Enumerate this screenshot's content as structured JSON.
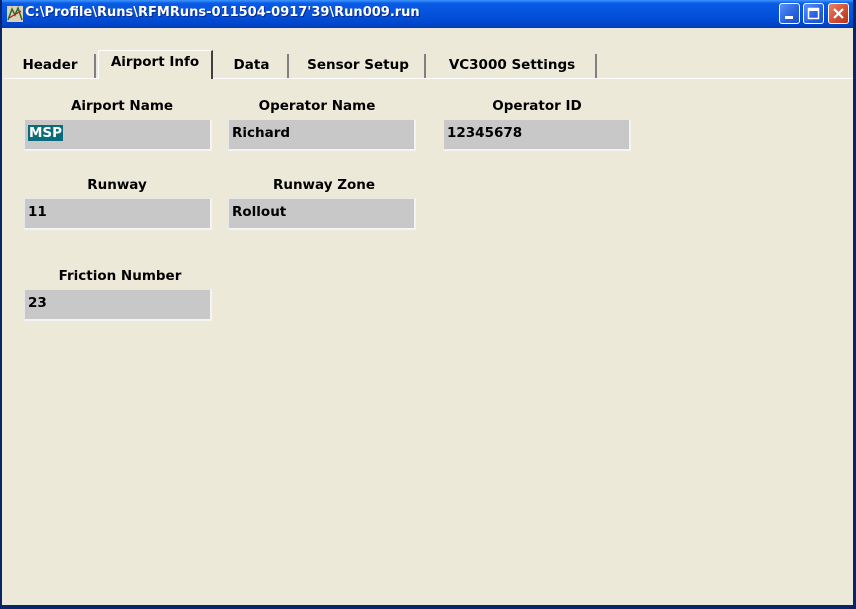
{
  "window": {
    "title": "C:\\Profile\\Runs\\RFMRuns-011504-0917'39\\Run009.run"
  },
  "tabs": [
    {
      "label": "Header"
    },
    {
      "label": "Airport Info",
      "active": true
    },
    {
      "label": "Data"
    },
    {
      "label": "Sensor Setup"
    },
    {
      "label": "VC3000 Settings"
    }
  ],
  "fields": {
    "airport_name": {
      "label": "Airport Name",
      "value": "MSP"
    },
    "operator_name": {
      "label": "Operator Name",
      "value": "Richard"
    },
    "operator_id": {
      "label": "Operator ID",
      "value": "12345678"
    },
    "runway": {
      "label": "Runway",
      "value": "11"
    },
    "runway_zone": {
      "label": "Runway Zone",
      "value": "Rollout"
    },
    "friction_number": {
      "label": "Friction Number",
      "value": "23"
    }
  },
  "colors": {
    "titlebar": "#0453DC",
    "background": "#ECE9D8",
    "field": "#C8C8C8",
    "selection": "#0A6C7A"
  },
  "icons": [
    "app-icon",
    "minimize-icon",
    "maximize-icon",
    "close-icon"
  ]
}
